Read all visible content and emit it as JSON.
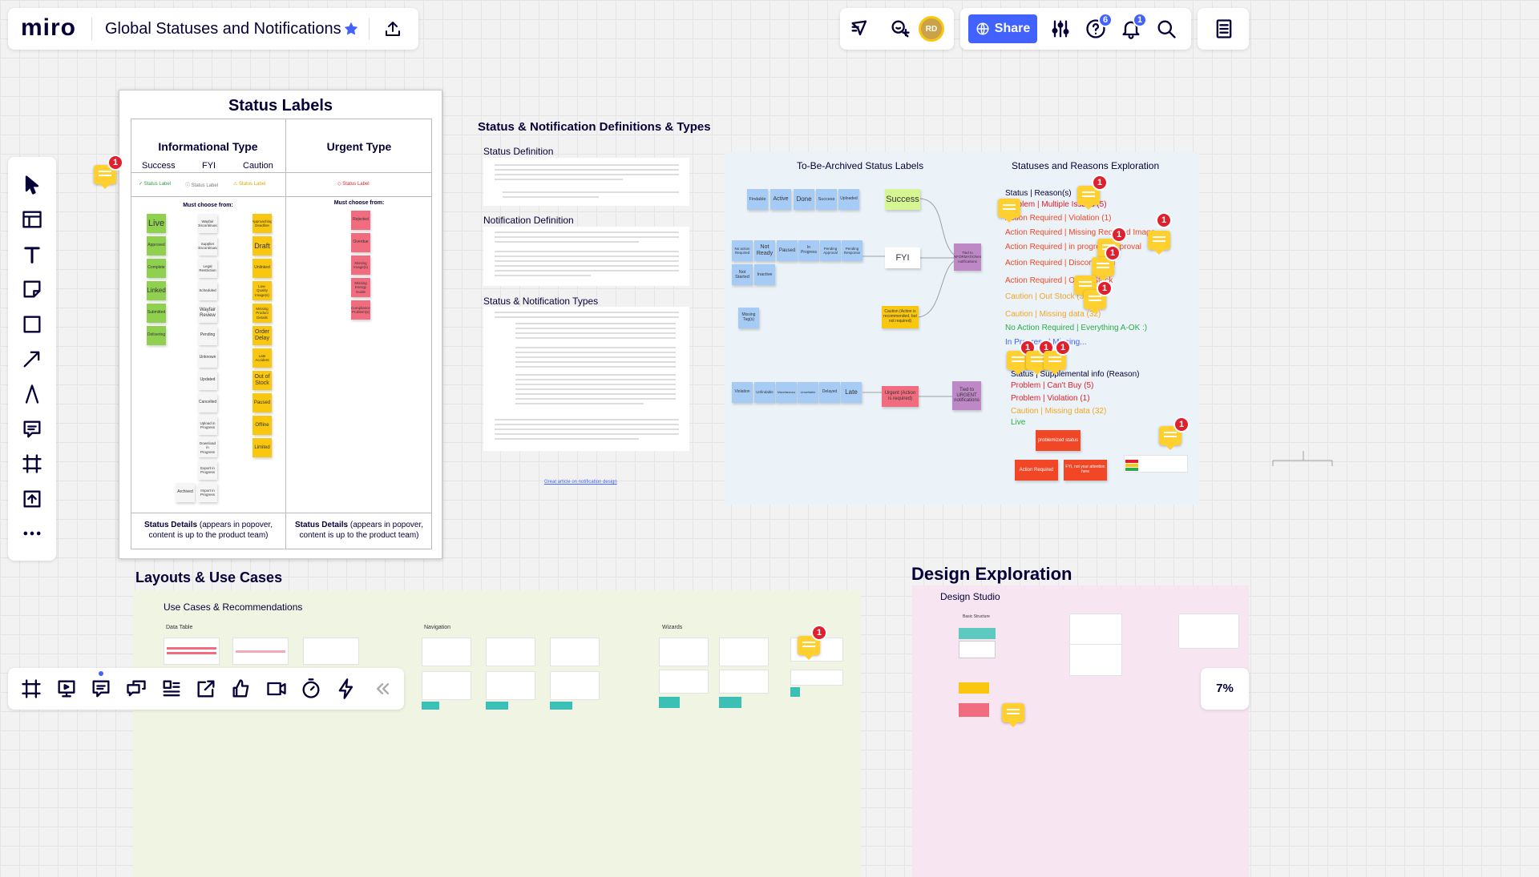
{
  "app": {
    "logo": "miro",
    "board_title": "Global Statuses and Notifications",
    "share_label": "Share",
    "avatar_initials": "RD",
    "help_badge": "6",
    "notif_badge": "1",
    "zoom": "7%",
    "accent": "#4262ff"
  },
  "status_labels": {
    "title": "Status Labels",
    "info_heading": "Informational Type",
    "urgent_heading": "Urgent Type",
    "sub": [
      "Success",
      "FYI",
      "Caution"
    ],
    "sample_success": "Status Label",
    "sample_fyi": "Status Label",
    "sample_caution": "Status Label",
    "sample_urgent": "Status Label",
    "must_choose": "Must choose from:",
    "must_choose_urgent": "Must choose from:",
    "green": [
      "Live",
      "Approved",
      "Complete",
      "Linked",
      "Submitted",
      "Delivering"
    ],
    "grey": [
      "Wayfair Discontinued",
      "Supplier Discontinued",
      "Legal Restriction",
      "Scheduled",
      "Wayfair Review",
      "Pending",
      "Unknown",
      "Updated",
      "Cancelled",
      "Upload in Progress",
      "Download in Progress",
      "Export in Progress",
      "Import in Progress"
    ],
    "archived": "Archived",
    "yellow": [
      "Approaching Deadline",
      "Draft",
      "Unlinked",
      "Low-Quality Image(s)",
      "Missing Product Details",
      "Order Delay",
      "Late Accident",
      "Out of Stock",
      "Paused",
      "Offline",
      "Limited"
    ],
    "red": [
      "Rejected",
      "Overdue",
      "Missing Image(s)",
      "Missing Energy Guide",
      "Compliance Problem(s)"
    ],
    "details_bold": "Status Details",
    "details_rest": " (appears in popover, content is up to the product team)"
  },
  "definitions": {
    "title": "Status & Notification Definitions & Types",
    "status_def": "Status Definition",
    "notif_def": "Notification Definition",
    "types": "Status & Notification Types",
    "link": "Great article on notification design"
  },
  "archived_labels": {
    "title": "To-Be-Archived Status Labels",
    "row1": [
      "Findable",
      "Active",
      "Done",
      "Success",
      "Uploaded"
    ],
    "row2": [
      "No action Required",
      "Not Ready",
      "Paused",
      "In Progress",
      "Pending Approval",
      "Pending Response"
    ],
    "row3": [
      "Not Started",
      "Inactive"
    ],
    "missing": "Missing Tag(s)",
    "row4": [
      "Violation",
      "Unfindable",
      "Miscellaneous",
      "Unsellable",
      "Delayed",
      "Late"
    ],
    "success": "Success",
    "fyi": "FYI",
    "caution": "Caution (Action is recommended, but not required)",
    "urgent": "Urgent (Action is required)",
    "tied_info": "Tied to INFORMATIONAL notifications",
    "tied_urgent": "Tied to URGENT notifications"
  },
  "exploration": {
    "title": "Statuses and Reasons Exploration",
    "header": "Status | Reason(s)",
    "rows": [
      "Problem | Multiple Issues (5)",
      "Action Required | Violation (1)",
      "Action Required | Missing Required Image",
      "Action Required | in progress approval",
      "Action Required | Discontinued",
      "Action Required | Out of Stock",
      "Caution | Out Stock (32)",
      "Caution | Missing data (32)",
      "No Action Required | Everything A-OK :)",
      "In Progress | Missing..."
    ],
    "header2": "Status | Supplemental info (Reason)",
    "rows2": [
      "Problem | Can't Buy (5)",
      "Problem | Violation (1)",
      "Caution | Missing data (32)",
      "Live"
    ],
    "problem": "problemized status",
    "action": "Action Required",
    "fyi": "FYI, not your attention here"
  },
  "layouts": {
    "title": "Layouts & Use Cases",
    "sub": "Use Cases & Recommendations",
    "data_table": "Data Table",
    "navigation": "Navigation",
    "wizards": "Wizards"
  },
  "design": {
    "title": "Design Exploration",
    "sub": "Design Studio",
    "basic": "Basic Structure"
  },
  "comment_badges": [
    "1",
    "1",
    "1",
    "1",
    "1",
    "1",
    "1",
    "1",
    "1",
    "1",
    "1",
    "1"
  ]
}
